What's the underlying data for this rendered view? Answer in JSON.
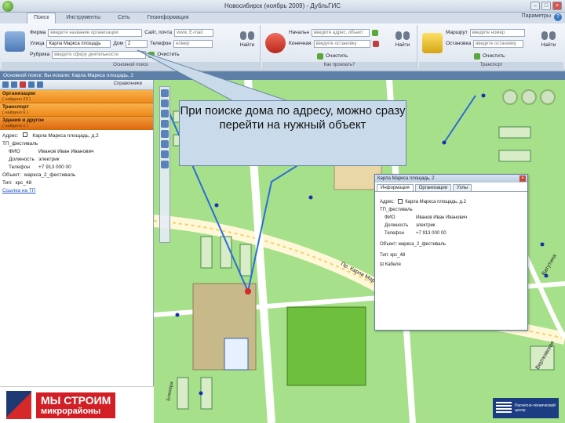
{
  "window": {
    "title": "Новосибирск (ноябрь 2009) - ДубльГИС",
    "minimize": "–",
    "maximize": "□",
    "close": "×"
  },
  "tabs": {
    "items": [
      "Поиск",
      "Инструменты",
      "Сеть",
      "Геоинформация"
    ],
    "params": "Параметры",
    "help": "?"
  },
  "ribbon": {
    "main_search": {
      "label": "Основной поиск",
      "firm_label": "Фирма",
      "firm_placeholder": "введите название организации",
      "street_label": "Улица",
      "street_value": "Карла Маркса площадь",
      "house_label": "Дом",
      "house_value": "2",
      "rubric_label": "Рубрика",
      "rubric_placeholder": "введите сферу деятельности",
      "site_label": "Сайт, почта",
      "site_value": "www, E-mail",
      "phone_label": "Телефон",
      "phone_value": "номер",
      "find_label": "Найти",
      "clear_label": "Очистить"
    },
    "how_to_get": {
      "label": "Как проехать?",
      "from_label": "Начальн",
      "from_placeholder": "введите адрес, объект",
      "to_label": "Конечная",
      "to_placeholder": "введите остановку",
      "find_label": "Найти",
      "clear_label": "Очистить"
    },
    "transport": {
      "label": "Транспорт",
      "route_label": "Маршрут",
      "route_placeholder": "введите номер",
      "stop_label": "Остановка",
      "stop_placeholder": "введите остановку",
      "find_label": "Найти",
      "clear_label": "Очистить"
    }
  },
  "breadcrumb": "Основной поиск: Вы искали: Карла Маркса площадь, 2",
  "left_panel": {
    "reference": "Справочники",
    "categories": [
      {
        "title": "Организации",
        "sub": "( найдено 23 )"
      },
      {
        "title": "Транспорт",
        "sub": "( найдено 6 )"
      },
      {
        "title": "Здания и другое",
        "sub": "( найдено 1 )"
      }
    ],
    "details": {
      "address_label": "Адрес:",
      "address_value": "Карла Маркса площадь, д.2",
      "tp_label": "ТП_фестиваль",
      "fio_label": "ФИО",
      "fio_value": "Иванов Иван Иванович",
      "position_label": "Должность",
      "position_value": "электрик",
      "phone_label": "Телефон",
      "phone_value": "+7 913 000 00",
      "object_label": "Объект:",
      "object_value": "маркса_2_фестиваль",
      "type_label": "Тип:",
      "type_value": "крс_48",
      "link": "Ссылка на ТП"
    },
    "banner_line1": "МЫ СТРОИМ",
    "banner_line2": "микрорайоны"
  },
  "callout": {
    "text": "При поиске дома по адресу, можно сразу перейти на нужный объект"
  },
  "info_window": {
    "title": "Карла Маркса площадь, 2",
    "close": "×",
    "tabs": [
      "Информация",
      "Организации",
      "Узлы"
    ],
    "address_label": "Адрес:",
    "address_value": "Карла Маркса площадь, д.2",
    "tp_label": "ТП_фестиваль",
    "fio_label": "ФИО",
    "fio_value": "Иванов Иван Иванович",
    "position_label": "Должность",
    "position_value": "электрик",
    "phone_label": "Телефон",
    "phone_value": "+7 913 000 00",
    "object_label": "Объект:",
    "object_value": "маркса_2_фестиваль",
    "type_label": "Тип:",
    "type_value": "крс_48",
    "cable_label": "Кабеля"
  },
  "map": {
    "streets": [
      "Пр. Карла Маркса",
      "Ватутина",
      "Вертковская",
      "Блюхера"
    ],
    "corner_logo": "Расчетно-технический центр"
  },
  "colors": {
    "ribbon": "#dde5ef",
    "accent_orange": "#ee8a1c",
    "map_green": "#a7e08a",
    "callout": "#c9dbea"
  }
}
